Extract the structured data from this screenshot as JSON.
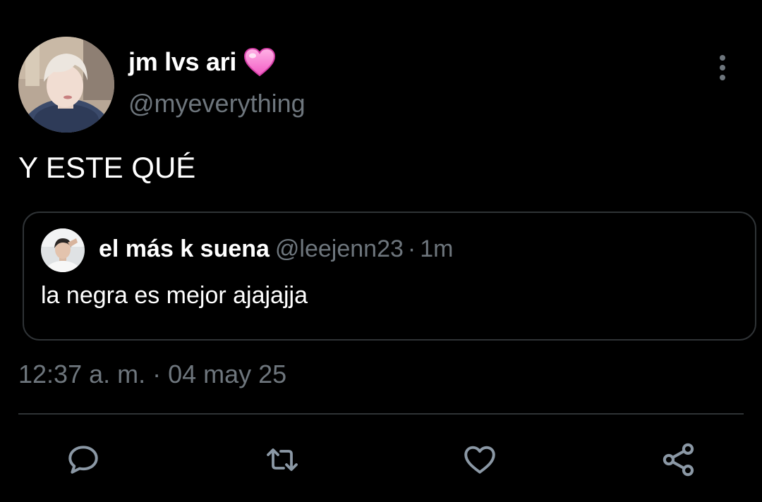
{
  "tweet": {
    "author": {
      "display_name": "jm lvs ari",
      "emoji": "pink-heart-icon",
      "handle": "@myeverything"
    },
    "text": "Y ESTE QUÉ",
    "quoted": {
      "display_name": "el más k suena",
      "handle": "@leejenn23",
      "separator": "·",
      "time_ago": "1m",
      "text": "la negra es mejor ajajajja"
    },
    "timestamp": "12:37 a. m. · 04 may 25"
  },
  "actions": {
    "reply_icon": "reply-icon",
    "retweet_icon": "retweet-icon",
    "like_icon": "like-icon",
    "share_icon": "share-icon"
  },
  "colors": {
    "background": "#000000",
    "text": "#ffffff",
    "secondary_text": "#6e767d",
    "border": "#2f3336",
    "action_icon": "#8b98a5"
  }
}
